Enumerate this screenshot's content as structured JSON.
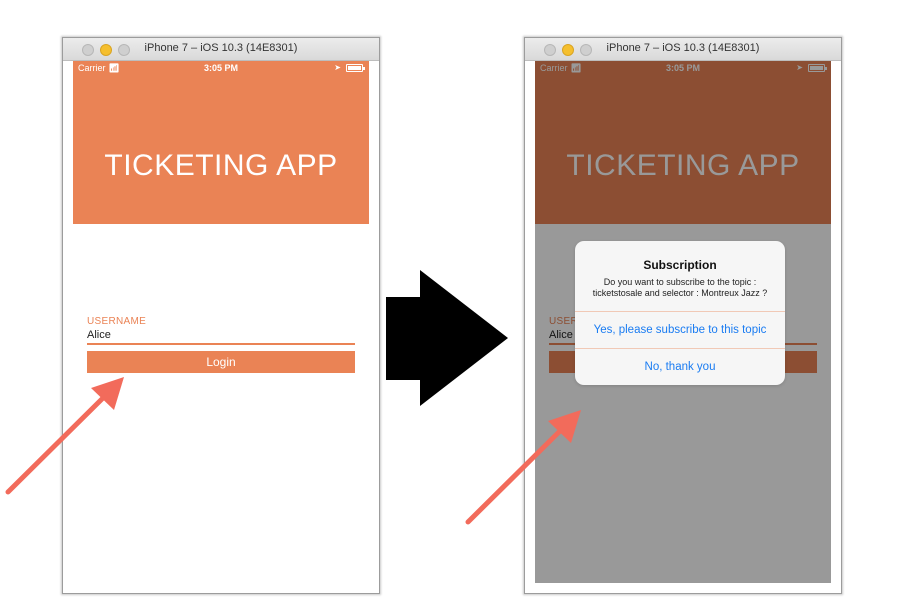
{
  "simulator": {
    "window_title": "iPhone 7 – iOS 10.3 (14E8301)"
  },
  "status_bar": {
    "carrier": "Carrier",
    "time": "3:05 PM"
  },
  "app": {
    "title": "TICKETING APP",
    "brand_color": "#ea8355"
  },
  "login_form": {
    "username_label": "USERNAME",
    "username_value": "Alice",
    "username_truncated": "Alice",
    "username_label_truncated": "USERN",
    "login_button": "Login"
  },
  "alert": {
    "title": "Subscription",
    "message": "Do you want to subscribe to the topic : ticketstosale and selector : Montreux Jazz ?",
    "confirm_button": "Yes, please subscribe to this topic",
    "cancel_button": "No, thank you",
    "button_color": "#1a7cf2"
  },
  "annotations": {
    "arrow_color": "#f26b5b",
    "transition_arrow_color": "#000000"
  }
}
